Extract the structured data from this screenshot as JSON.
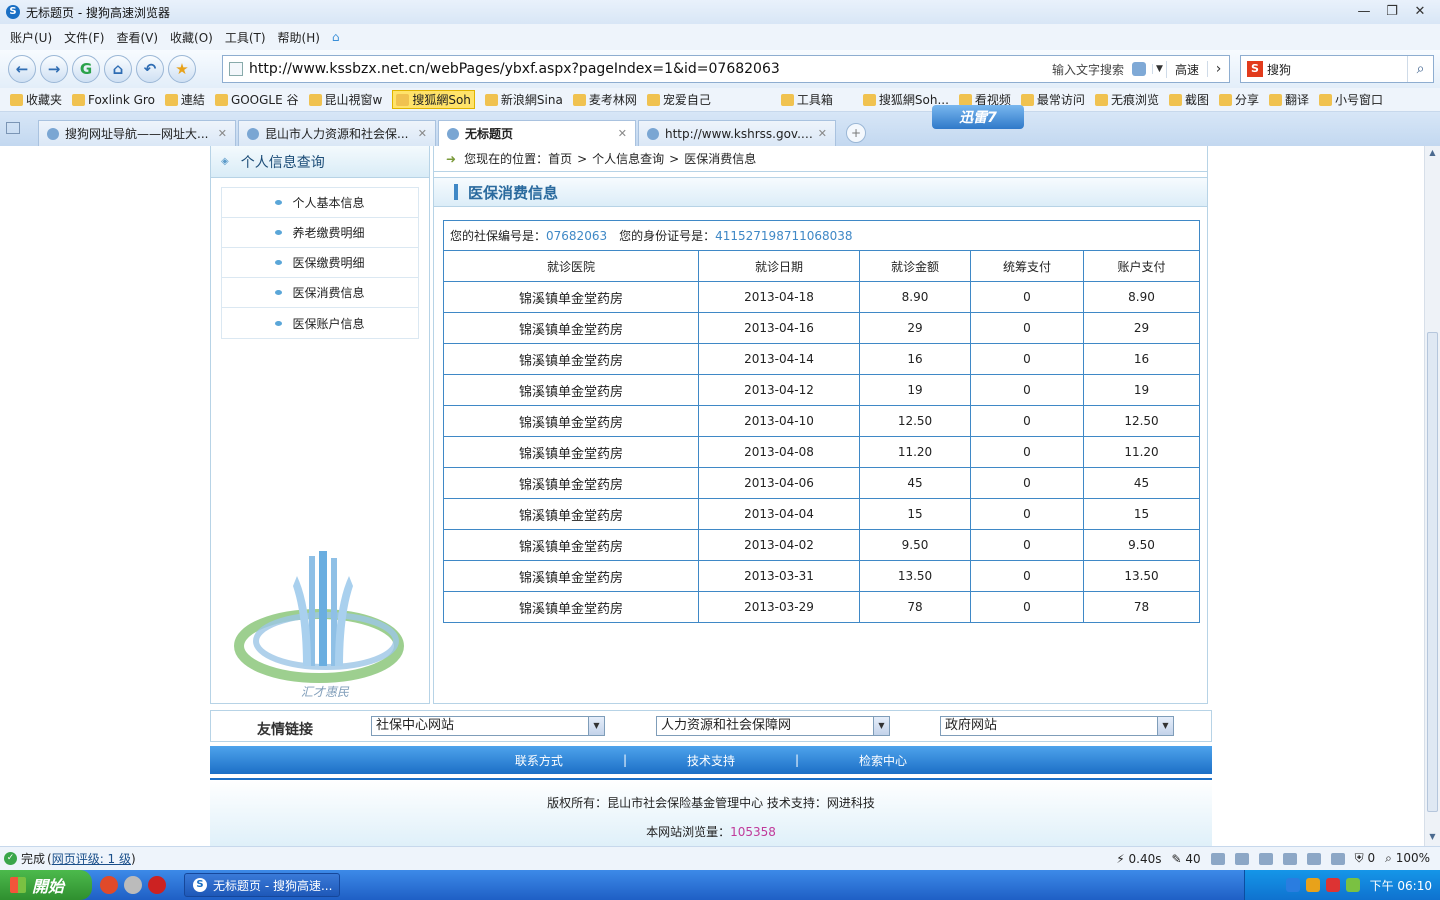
{
  "window": {
    "title": "无标题页 - 搜狗高速浏览器"
  },
  "menu": {
    "items": [
      "账户(U)",
      "文件(F)",
      "查看(V)",
      "收藏(O)",
      "工具(T)",
      "帮助(H)"
    ]
  },
  "nav": {
    "url": "http://www.kssbzx.net.cn/webPages/ybxf.aspx?pageIndex=1&id=07682063",
    "search_hint": "输入文字搜索",
    "speed_label": "高速",
    "search_engine": "搜狗"
  },
  "favorites": {
    "items": [
      "收藏夹",
      "Foxlink Gro",
      "連結",
      "GOOGLE 谷",
      "昆山視窗w",
      "搜狐網Soh",
      "新浪網Sina",
      "麦考林网",
      "宠爱自己",
      "工具箱",
      "搜狐網Soh...",
      "看视频",
      "最常访问",
      "无痕浏览",
      "截图",
      "分享",
      "翻译",
      "小号窗口"
    ]
  },
  "tabs": [
    {
      "label": "搜狗网址导航——网址大..."
    },
    {
      "label": "昆山市人力资源和社会保..."
    },
    {
      "label": "无标题页"
    },
    {
      "label": "http://www.kshrss.gov.cn/..."
    }
  ],
  "xunlei_label": "迅雷7",
  "sidebar": {
    "heading": "个人信息查询",
    "items": [
      "个人基本信息",
      "养老缴费明细",
      "医保缴费明细",
      "医保消费信息",
      "医保账户信息"
    ],
    "logo_caption": "汇才惠民"
  },
  "breadcrumb": {
    "prefix": "您现在的位置：",
    "home": "首页",
    "sep": ">",
    "level1": "个人信息查询",
    "level2": "医保消费信息"
  },
  "panel": {
    "title": "医保消费信息",
    "si_label": "您的社保编号是：",
    "si_number": "07682063",
    "id_label": "您的身份证号是：",
    "id_number": "411527198711068038"
  },
  "table": {
    "headers": [
      "就诊医院",
      "就诊日期",
      "就诊金额",
      "统筹支付",
      "账户支付"
    ],
    "rows": [
      [
        "锦溪镇单金堂药房",
        "2013-04-18",
        "8.90",
        "0",
        "8.90"
      ],
      [
        "锦溪镇单金堂药房",
        "2013-04-16",
        "29",
        "0",
        "29"
      ],
      [
        "锦溪镇单金堂药房",
        "2013-04-14",
        "16",
        "0",
        "16"
      ],
      [
        "锦溪镇单金堂药房",
        "2013-04-12",
        "19",
        "0",
        "19"
      ],
      [
        "锦溪镇单金堂药房",
        "2013-04-10",
        "12.50",
        "0",
        "12.50"
      ],
      [
        "锦溪镇单金堂药房",
        "2013-04-08",
        "11.20",
        "0",
        "11.20"
      ],
      [
        "锦溪镇单金堂药房",
        "2013-04-06",
        "45",
        "0",
        "45"
      ],
      [
        "锦溪镇单金堂药房",
        "2013-04-04",
        "15",
        "0",
        "15"
      ],
      [
        "锦溪镇单金堂药房",
        "2013-04-02",
        "9.50",
        "0",
        "9.50"
      ],
      [
        "锦溪镇单金堂药房",
        "2013-03-31",
        "13.50",
        "0",
        "13.50"
      ],
      [
        "锦溪镇单金堂药房",
        "2013-03-29",
        "78",
        "0",
        "78"
      ]
    ]
  },
  "friend_links": {
    "label": "友情链接",
    "selects": [
      "社保中心网站",
      "人力资源和社会保障网",
      "政府网站"
    ]
  },
  "footer": {
    "links": [
      "联系方式",
      "技术支持",
      "检索中心"
    ],
    "link_sep": "|",
    "copyright": "版权所有：昆山市社会保险基金管理中心  技术支持：网进科技",
    "visits_label": "本网站浏览量：",
    "visits": "105358"
  },
  "status": {
    "text": "完成",
    "rating": "网页评级: 1 级",
    "load_time": "0.40s",
    "count": "40",
    "zero": "0",
    "zoom": "100%"
  },
  "taskbar": {
    "start_label": "開始",
    "task_label": "无标题页 - 搜狗高速...",
    "clock": "下午 06:10"
  },
  "colors": {
    "accent": "#3f88c6",
    "footer_bar": "#1c6fc6",
    "visit_count": "#c03a9a"
  }
}
